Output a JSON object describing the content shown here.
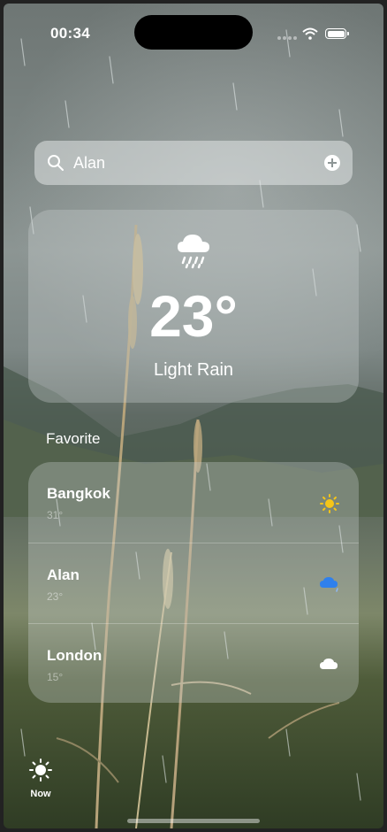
{
  "status_bar": {
    "time": "00:34"
  },
  "search": {
    "value": "Alan",
    "icon": "search-icon",
    "action_icon": "add-circle-icon"
  },
  "current": {
    "icon": "cloud-rain-icon",
    "temperature": "23°",
    "condition": "Light Rain"
  },
  "favorites": {
    "title": "Favorite",
    "items": [
      {
        "city": "Bangkok",
        "temp": "31°",
        "icon": "sun-icon",
        "icon_color": "#F5C518"
      },
      {
        "city": "Alan",
        "temp": "23°",
        "icon": "cloud-rain-icon",
        "icon_color": "#2F80ED"
      },
      {
        "city": "London",
        "temp": "15°",
        "icon": "cloud-icon",
        "icon_color": "#FFFFFF"
      }
    ]
  },
  "tab_bar": {
    "now_label": "Now",
    "now_icon": "sun-icon"
  }
}
